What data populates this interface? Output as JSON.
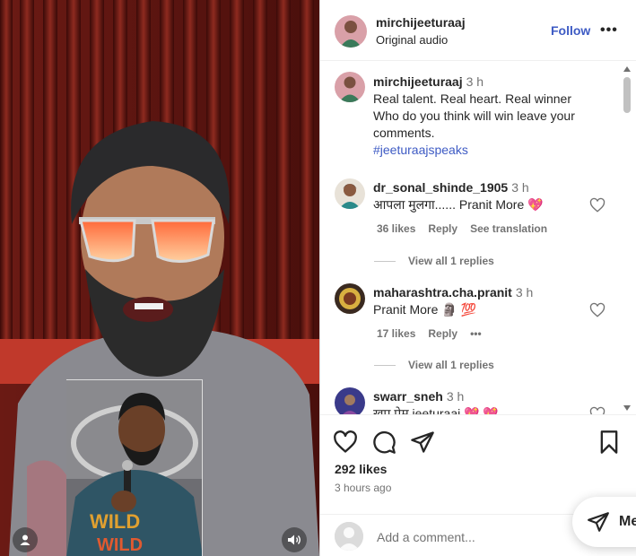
{
  "post": {
    "username": "mirchijeeturaaj",
    "audio": "Original audio",
    "follow_label": "Follow",
    "more_label": "•••",
    "caption": {
      "username": "mirchijeeturaaj",
      "time": "3 h",
      "line1": "Real talent. Real heart. Real winner",
      "line2": "Who do you think will win leave your",
      "line3": "comments.",
      "hashtag": "#jeeturaajspeaks"
    },
    "likes": "292 likes",
    "posted_ago": "3 hours ago"
  },
  "comments": [
    {
      "username": "dr_sonal_shinde_1905",
      "time": "3 h",
      "text": "आपला मुलगा...... Pranit More 💖",
      "likes": "36 likes",
      "reply": "Reply",
      "translate": "See translation",
      "view_replies": "View all 1 replies"
    },
    {
      "username": "maharashtra.cha.pranit",
      "time": "3 h",
      "text": "Pranit More 🗿 💯",
      "likes": "17 likes",
      "reply": "Reply",
      "more": "•••",
      "view_replies": "View all 1 replies"
    },
    {
      "username": "swarr_sneh",
      "time": "3 h",
      "text": "खुप प्रेम jeeturaaj 💖 💖"
    }
  ],
  "add_comment": {
    "placeholder": "Add a comment..."
  },
  "messages": {
    "label": "Me"
  },
  "icons": {
    "like": "heart-icon",
    "comment": "comment-icon",
    "share": "paper-plane-icon",
    "save": "bookmark-icon",
    "tag": "user-tag-icon",
    "mute": "speaker-icon"
  },
  "colors": {
    "link": "#3e5bc4",
    "secondary_text": "#737373",
    "primary_text": "#262626"
  }
}
